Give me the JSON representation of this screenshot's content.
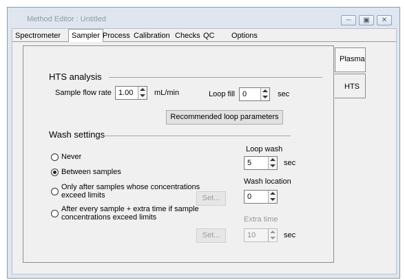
{
  "window": {
    "title": "Method Editor : Untitled",
    "controls": [
      "minimize-icon",
      "maximize-icon",
      "close-icon"
    ]
  },
  "tabs": [
    {
      "label": "Spectrometer",
      "active": false
    },
    {
      "label": "Sampler",
      "active": true
    },
    {
      "label": "Process",
      "active": false
    },
    {
      "label": "Calibration",
      "active": false
    },
    {
      "label": "Checks",
      "active": false
    },
    {
      "label": "QC",
      "active": false
    },
    {
      "label": "Options",
      "active": false
    }
  ],
  "side_tabs": [
    {
      "label": "Plasma",
      "active": false
    },
    {
      "label": "HTS",
      "active": true
    }
  ],
  "hts": {
    "heading": "HTS analysis",
    "flow_rate_label": "Sample flow rate",
    "flow_rate_value": "1.00",
    "flow_rate_unit": "mL/min",
    "loop_fill_label": "Loop fill",
    "loop_fill_value": "0",
    "loop_fill_unit": "sec",
    "recommended_button": "Recommended loop parameters"
  },
  "wash": {
    "heading": "Wash settings",
    "options": [
      {
        "label": "Never",
        "selected": false
      },
      {
        "label": "Between samples",
        "selected": true
      },
      {
        "label": "Only after samples whose concentrations",
        "label2": "exceed limits",
        "selected": false
      },
      {
        "label": "After every sample + extra time if sample",
        "label2": "concentrations exceed limits",
        "selected": false
      }
    ],
    "set_button_1": "Set...",
    "set_button_2": "Set...",
    "loop_wash_label": "Loop wash",
    "loop_wash_value": "5",
    "loop_wash_unit": "sec",
    "wash_location_label": "Wash location",
    "wash_location_value": "0",
    "extra_time_label": "Extra time",
    "extra_time_value": "10",
    "extra_time_unit": "sec"
  }
}
